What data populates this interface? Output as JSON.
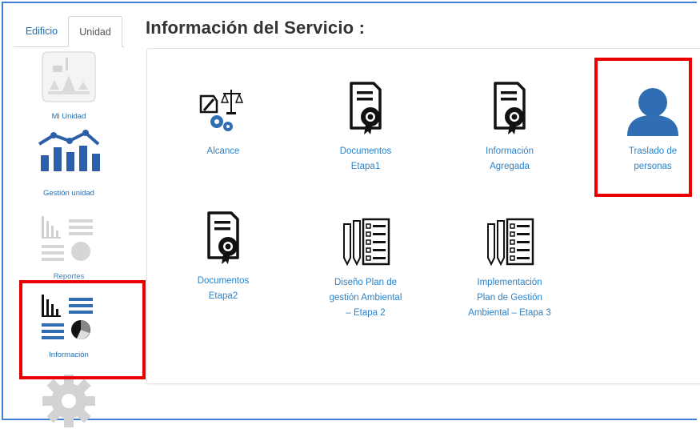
{
  "sidebar": {
    "tabs": [
      {
        "label": "Edificio"
      },
      {
        "label": "Unidad"
      }
    ],
    "items": [
      {
        "label": "Mi Unidad",
        "icon": "building-icon"
      },
      {
        "label": "Gestión unidad",
        "icon": "bar-line-chart-icon"
      },
      {
        "label": "Reportes",
        "icon": "reports-chart-icon"
      },
      {
        "label": "Información",
        "icon": "information-chart-icon"
      },
      {
        "label": "",
        "icon": "gear-icon"
      }
    ]
  },
  "main": {
    "title": "Información del Servicio :",
    "services": [
      {
        "label": "Alcance",
        "icon": "scales-gears-icon"
      },
      {
        "label_lines": [
          "Documentos",
          "Etapa1"
        ],
        "icon": "certificate-icon"
      },
      {
        "label_lines": [
          "Información",
          "Agregada"
        ],
        "icon": "certificate-icon"
      },
      {
        "label_lines": [
          "Traslado de",
          "personas"
        ],
        "icon": "user-icon"
      },
      {
        "label_lines": [
          "Documentos",
          "Etapa2"
        ],
        "icon": "certificate-icon"
      },
      {
        "label_lines": [
          "Diseño Plan de",
          "gestión Ambiental",
          "– Etapa 2"
        ],
        "icon": "checklist-pencil-icon"
      },
      {
        "label_lines": [
          "Implementación",
          "Plan de Gestión",
          "Ambiental – Etapa 3"
        ],
        "icon": "checklist-pencil-icon"
      }
    ]
  },
  "colors": {
    "accent": "#1e6db6",
    "link": "#2a82c9",
    "highlight": "#ea0000",
    "icon_blue": "#2f6eb3",
    "frame": "#3c7fd4"
  }
}
